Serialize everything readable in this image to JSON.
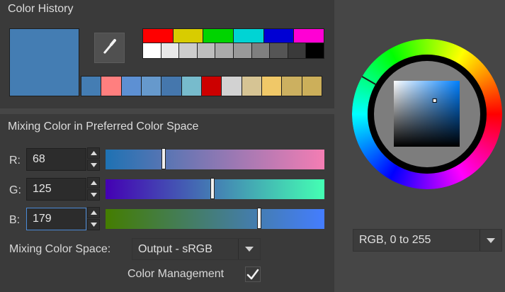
{
  "color_history": {
    "title": "Color History",
    "current_color": "#447db3",
    "palette_row_top": [
      "#ff0000",
      "#d8cc00",
      "#00d400",
      "#00d4d4",
      "#0000d4",
      "#ff00d4"
    ],
    "palette_row_bottom": [
      "#ffffff",
      "#e8e8e8",
      "#cccccc",
      "#bdbdbd",
      "#aaaaaa",
      "#999999",
      "#7f7f7f",
      "#555555",
      "#3a3a3a",
      "#000000"
    ],
    "recent_colors": [
      "#447db3",
      "#ff7f7f",
      "#5d90d3",
      "#6699cc",
      "#4577ad",
      "#77bbcc",
      "#cc0000",
      "#d2d2d2",
      "#d6c494",
      "#f0c868",
      "#ccb060",
      "#ccaf5a"
    ],
    "picker_icon": "eyedropper-icon"
  },
  "mixing": {
    "title": "Mixing Color in Preferred Color Space",
    "channels": [
      {
        "label": "R:",
        "value": "68",
        "gradient": [
          "#1e72b3",
          "#f47db3"
        ],
        "fraction": 0.2667
      },
      {
        "label": "G:",
        "value": "125",
        "gradient": [
          "#4400b3",
          "#44ffb3"
        ],
        "fraction": 0.4902
      },
      {
        "label": "B:",
        "value": "179",
        "gradient": [
          "#447d00",
          "#447dff"
        ],
        "fraction": 0.702
      }
    ],
    "space_label": "Mixing Color Space:",
    "space_value": "Output - sRGB",
    "management_label": "Color Management",
    "management_checked": true
  },
  "wheel": {
    "hue_degrees": 210,
    "sv_saturation": 0.62,
    "sv_value": 0.7,
    "model_value": "RGB, 0 to 255"
  }
}
